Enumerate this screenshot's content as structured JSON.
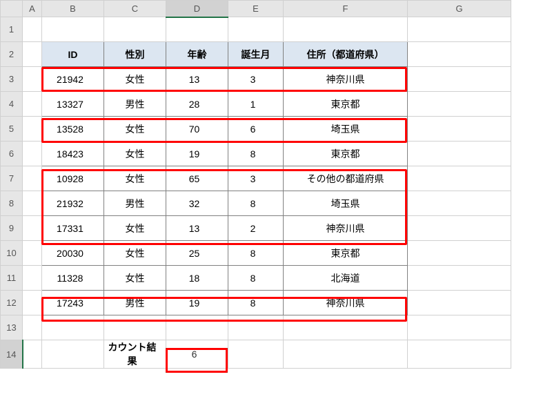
{
  "columns": [
    "A",
    "B",
    "C",
    "D",
    "E",
    "F",
    "G"
  ],
  "headers": {
    "id": "ID",
    "gender": "性別",
    "age": "年齢",
    "birth_month": "誕生月",
    "address": "住所（都道府県）"
  },
  "rows": [
    {
      "id": "21942",
      "gender": "女性",
      "age": "13",
      "birth_month": "3",
      "address": "神奈川県",
      "highlighted": true
    },
    {
      "id": "13327",
      "gender": "男性",
      "age": "28",
      "birth_month": "1",
      "address": "東京都",
      "highlighted": false
    },
    {
      "id": "13528",
      "gender": "女性",
      "age": "70",
      "birth_month": "6",
      "address": "埼玉県",
      "highlighted": true
    },
    {
      "id": "18423",
      "gender": "女性",
      "age": "19",
      "birth_month": "8",
      "address": "東京都",
      "highlighted": false
    },
    {
      "id": "10928",
      "gender": "女性",
      "age": "65",
      "birth_month": "3",
      "address": "その他の都道府県",
      "highlighted": true
    },
    {
      "id": "21932",
      "gender": "男性",
      "age": "32",
      "birth_month": "8",
      "address": "埼玉県",
      "highlighted": true
    },
    {
      "id": "17331",
      "gender": "女性",
      "age": "13",
      "birth_month": "2",
      "address": "神奈川県",
      "highlighted": true
    },
    {
      "id": "20030",
      "gender": "女性",
      "age": "25",
      "birth_month": "8",
      "address": "東京都",
      "highlighted": false
    },
    {
      "id": "11328",
      "gender": "女性",
      "age": "18",
      "birth_month": "8",
      "address": "北海道",
      "highlighted": false
    },
    {
      "id": "17243",
      "gender": "男性",
      "age": "19",
      "birth_month": "8",
      "address": "神奈川県",
      "highlighted": true
    }
  ],
  "result_label": "カウント結果",
  "result_value": "6",
  "active_cell": "D14",
  "row_header_count": 14
}
